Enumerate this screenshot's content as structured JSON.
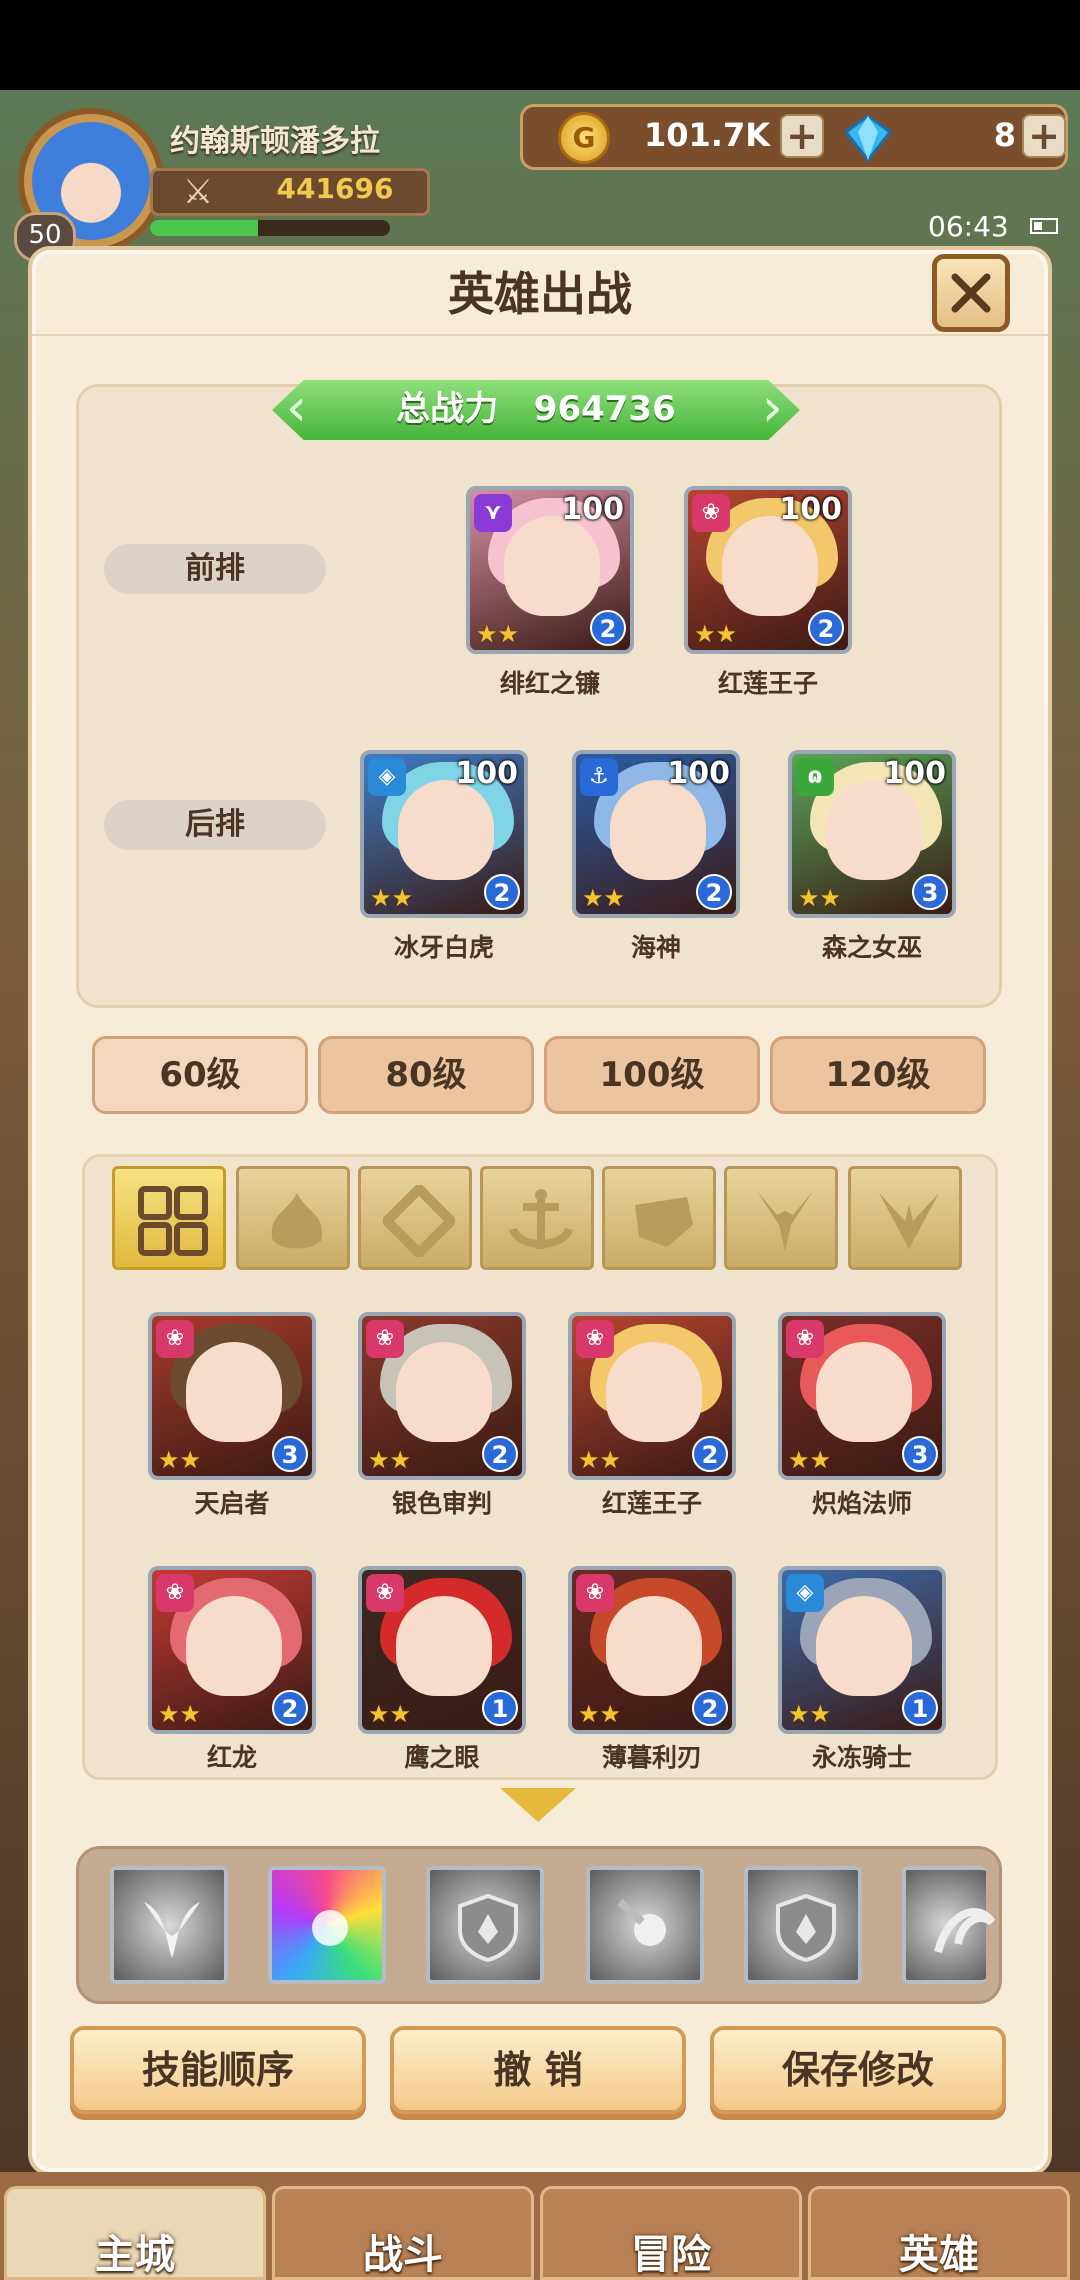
{
  "player": {
    "name": "约翰斯顿潘多拉",
    "level": "50",
    "power": "441696",
    "xp_fraction": 0.45
  },
  "currency": {
    "gold": "101.7K",
    "gems": "8",
    "plus": "+"
  },
  "status": {
    "time": "06:43"
  },
  "dialog": {
    "title": "英雄出战",
    "total_power_label": "总战力",
    "total_power": "964736",
    "front_row_label": "前排",
    "back_row_label": "后排"
  },
  "lineup": {
    "front": [
      {
        "name": "绯红之镰",
        "level": "100",
        "rank": "2",
        "stars": "★★",
        "element": "purple",
        "hair": "#f6c2cf",
        "bg": "#d48fa4"
      },
      {
        "name": "红莲王子",
        "level": "100",
        "rank": "2",
        "stars": "★★",
        "element": "red",
        "hair": "#f2c86a",
        "bg": "#b64530"
      }
    ],
    "back": [
      {
        "name": "冰牙白虎",
        "level": "100",
        "rank": "2",
        "stars": "★★",
        "element": "blue",
        "hair": "#7fd4e6",
        "bg": "#3d7cc4"
      },
      {
        "name": "海神",
        "level": "100",
        "rank": "2",
        "stars": "★★",
        "element": "anchor",
        "hair": "#8fb8e6",
        "bg": "#2b5ca6"
      },
      {
        "name": "森之女巫",
        "level": "100",
        "rank": "3",
        "stars": "★★",
        "element": "green",
        "hair": "#f3e5b5",
        "bg": "#5aa65a"
      }
    ]
  },
  "tiers": [
    "60级",
    "80级",
    "100级",
    "120级"
  ],
  "filters": [
    "grid-icon",
    "flame-icon",
    "diamond-icon",
    "anchor-icon",
    "beast-icon",
    "horns-icon",
    "wing-icon"
  ],
  "pool": [
    {
      "name": "天启者",
      "rank": "3",
      "stars": "★★",
      "hair": "#6b4a2f",
      "bg": "#a83b2a"
    },
    {
      "name": "银色审判",
      "rank": "2",
      "stars": "★★",
      "hair": "#c8c3b8",
      "bg": "#8a3a2a"
    },
    {
      "name": "红莲王子",
      "rank": "2",
      "stars": "★★",
      "hair": "#f2c86a",
      "bg": "#b64530"
    },
    {
      "name": "炽焰法师",
      "rank": "3",
      "stars": "★★",
      "hair": "#e85a5a",
      "bg": "#7a2e28"
    },
    {
      "name": "红龙",
      "rank": "2",
      "stars": "★★",
      "hair": "#e46a72",
      "bg": "#c43a34"
    },
    {
      "name": "鹰之眼",
      "rank": "1",
      "stars": "★★",
      "hair": "#d42a2a",
      "bg": "#3a2a22"
    },
    {
      "name": "薄暮利刃",
      "rank": "2",
      "stars": "★★",
      "hair": "#c64a2a",
      "bg": "#6a2a22"
    },
    {
      "name": "永冻骑士",
      "rank": "1",
      "stars": "★★",
      "hair": "#9aa6b8",
      "bg": "#3d6aa8"
    }
  ],
  "skills": [
    "wing-icon",
    "burst-icon",
    "shield-icon",
    "orb-icon",
    "shield-icon",
    "swirl-icon"
  ],
  "actions": {
    "skill_order": "技能顺序",
    "cancel": "撤 销",
    "save": "保存修改"
  },
  "nav": [
    "主城",
    "战斗",
    "冒险",
    "英雄"
  ],
  "colors": {
    "accent_green": "#45b43a",
    "rank_blue": "#2a6ad8",
    "panel": "#f7ecd8"
  }
}
